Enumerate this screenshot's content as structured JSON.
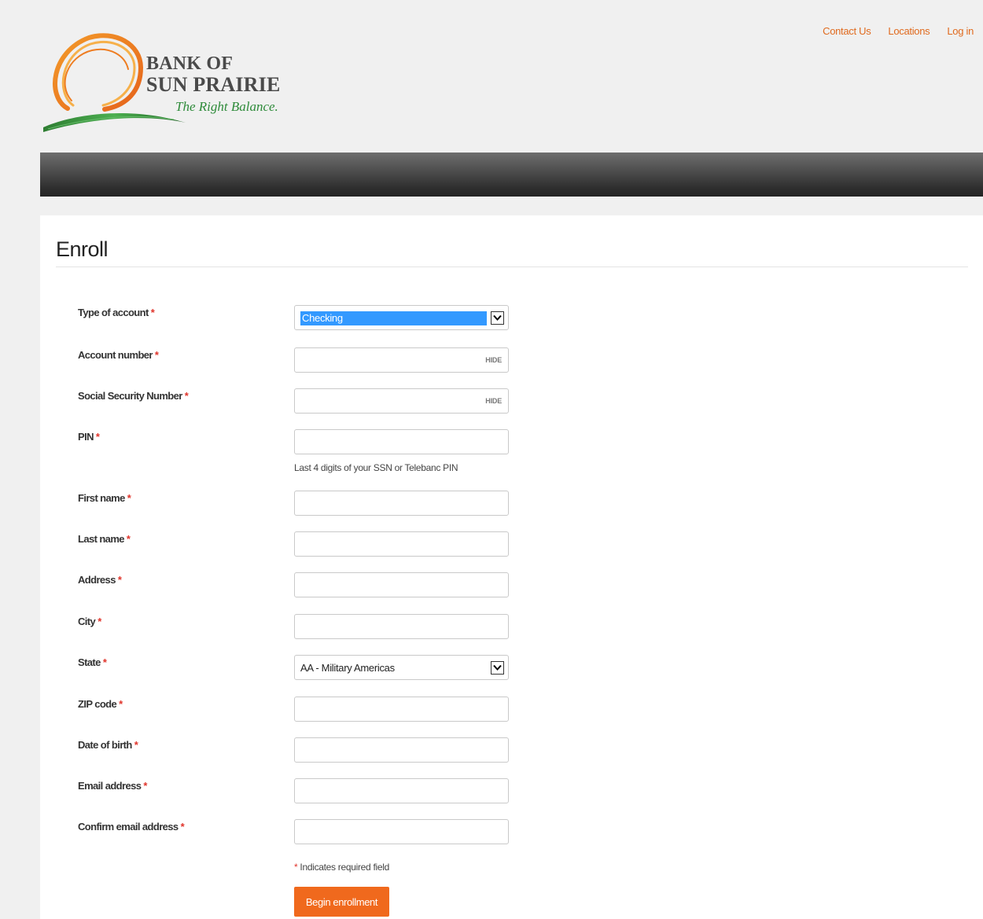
{
  "brand": {
    "line1": "BANK OF",
    "line2": "SUN PRAIRIE",
    "tagline": "The Right Balance.",
    "colors": {
      "accent": "#f0691d",
      "link": "#e06a1e",
      "tagline": "#2e8b3a",
      "required": "#e0342b"
    }
  },
  "util_nav": [
    {
      "label": "Contact Us"
    },
    {
      "label": "Locations"
    },
    {
      "label": "Log in"
    }
  ],
  "page": {
    "title": "Enroll"
  },
  "form": {
    "fields": [
      {
        "label": "Type of account",
        "type": "select",
        "value": "Checking"
      },
      {
        "label": "Account number",
        "type": "masked",
        "value": "",
        "toggle": "HIDE"
      },
      {
        "label": "Social Security Number",
        "type": "masked",
        "value": "",
        "toggle": "HIDE"
      },
      {
        "label": "PIN",
        "type": "text",
        "value": "",
        "help": "Last 4 digits of your SSN or Telebanc PIN"
      },
      {
        "label": "First name",
        "type": "text",
        "value": ""
      },
      {
        "label": "Last name",
        "type": "text",
        "value": ""
      },
      {
        "label": "Address",
        "type": "text",
        "value": ""
      },
      {
        "label": "City",
        "type": "text",
        "value": ""
      },
      {
        "label": "State",
        "type": "select",
        "value": "AA - Military Americas"
      },
      {
        "label": "ZIP code",
        "type": "text",
        "value": ""
      },
      {
        "label": "Date of birth",
        "type": "text",
        "value": ""
      },
      {
        "label": "Email address",
        "type": "text",
        "value": ""
      },
      {
        "label": "Confirm email address",
        "type": "text",
        "value": ""
      }
    ],
    "required_marker": "*",
    "required_note": "Indicates required field",
    "submit_label": "Begin enrollment"
  },
  "icons": {
    "dropdown": "chevron-down-icon",
    "logo": "sun-arc-logo"
  }
}
